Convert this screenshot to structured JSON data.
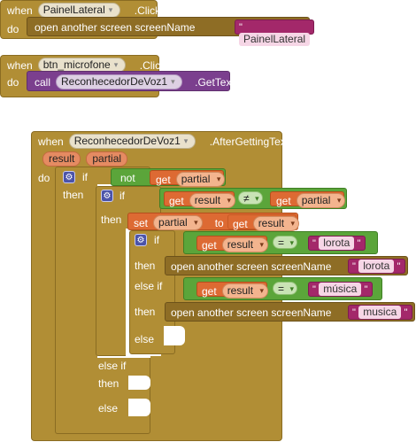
{
  "block1": {
    "when": "when",
    "component": "PainelLateral",
    "event": ".Click",
    "do": "do",
    "stmt": "open another screen  screenName",
    "value": "PainelLateral"
  },
  "block2": {
    "when": "when",
    "component": "btn_microfone",
    "event": ".Click",
    "do": "do",
    "call": "call",
    "component2": "ReconhecedorDeVoz1",
    "method": ".GetText"
  },
  "block3": {
    "when": "when",
    "component": "ReconhecedorDeVoz1",
    "event": ".AfterGettingText",
    "params": [
      "result",
      "partial"
    ],
    "do": "do",
    "if": "if",
    "not": "not",
    "get": "get",
    "partial": "partial",
    "result": "result",
    "then": "then",
    "neq": "≠",
    "set": "set",
    "to": "to",
    "eq": "=",
    "else_if": "else if",
    "else": "else",
    "open_screen": "open another screen  screenName",
    "lorota": "lorota",
    "musica_acc": "música",
    "musica": "musica"
  },
  "colors": {
    "event": "#b18e35",
    "procedure": "#7b3f8e",
    "variable": "#dd6a33",
    "logic": "#5ba53a",
    "text": "#a3286a",
    "mutator": "#4b53a8"
  }
}
